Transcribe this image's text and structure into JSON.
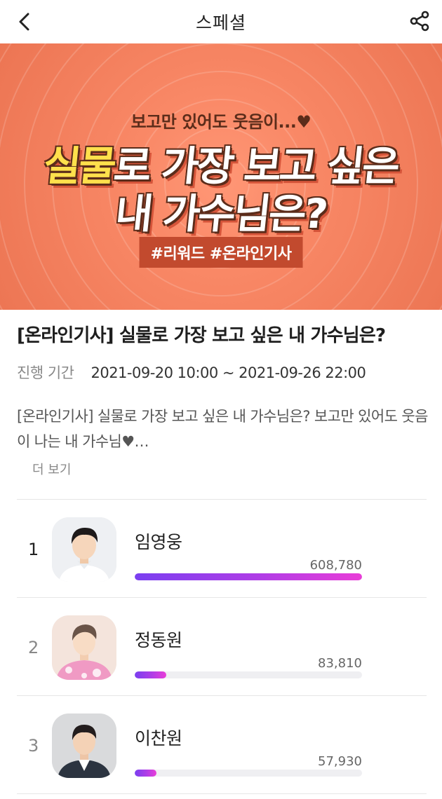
{
  "header": {
    "title": "스페셜",
    "back_icon": "chevron-left-icon",
    "share_icon": "share-icon"
  },
  "banner": {
    "top_text": "보고만 있어도 웃음이...♥",
    "title_highlight": "실물",
    "title_line1_rest": "로 가장 보고 싶은",
    "title_line2": "내 가수님은?",
    "tags": "#리워드 #온라인기사",
    "colors": {
      "background": "#f27e5c",
      "highlight": "#ffe04c",
      "tag_bg": "#c24a2e"
    }
  },
  "post": {
    "title": "[온라인기사] 실물로 가장 보고 싶은 내 가수님은?",
    "period_label": "진행 기간",
    "period_value": "2021-09-20 10:00 ~ 2021-09-26 22:00",
    "description": "[온라인기사] 실물로 가장 보고 싶은 내 가수님은? 보고만 있어도 웃음이 나는 내 가수님♥…",
    "more_label": "더 보기"
  },
  "ranking": [
    {
      "rank": "1",
      "name": "임영웅",
      "votes": "608,780",
      "share": 1.0
    },
    {
      "rank": "2",
      "name": "정동원",
      "votes": "83,810",
      "share": 0.1377
    },
    {
      "rank": "3",
      "name": "이찬원",
      "votes": "57,930",
      "share": 0.0952
    }
  ],
  "colors": {
    "bar_start": "#7a3ff0",
    "bar_end": "#e93dd8"
  }
}
